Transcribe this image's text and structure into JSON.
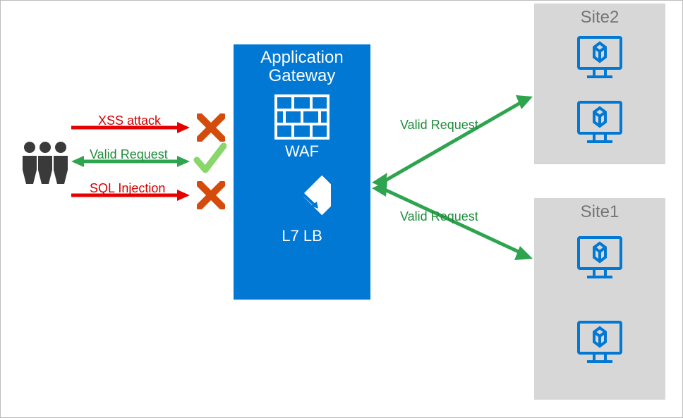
{
  "gateway": {
    "title_line1": "Application",
    "title_line2": "Gateway",
    "waf_label": "WAF",
    "lb_label": "L7 LB"
  },
  "sites": {
    "site1_label": "Site1",
    "site2_label": "Site2"
  },
  "flows": {
    "xss": "XSS attack",
    "valid_in": "Valid Request",
    "sql": "SQL Injection",
    "to_site2": "Valid Request",
    "to_site1": "Valid Request"
  },
  "colors": {
    "blue": "#0078d4",
    "green": "#2ea44f",
    "red": "#e60000",
    "orange": "#d44b0b"
  }
}
